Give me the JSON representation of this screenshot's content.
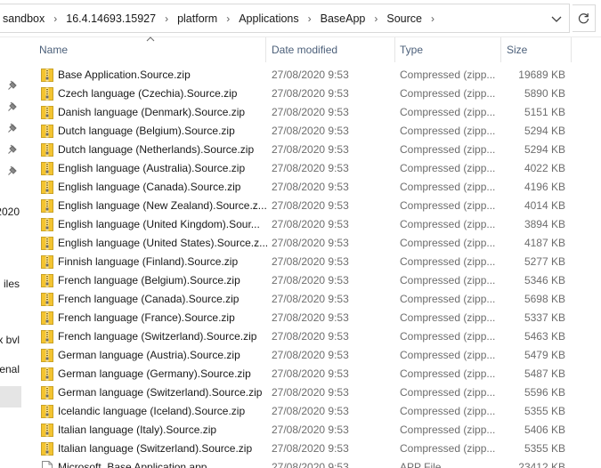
{
  "breadcrumb": [
    "sandbox",
    "16.4.14693.15927",
    "platform",
    "Applications",
    "BaseApp",
    "Source"
  ],
  "columns": {
    "name": "Name",
    "date": "Date modified",
    "type": "Type",
    "size": "Size"
  },
  "nav": {
    "pins": 5,
    "labels": [
      "2020",
      "iles",
      "x bvl",
      "enal"
    ]
  },
  "files": [
    {
      "name": "Base Application.Source.zip",
      "date": "27/08/2020 9:53",
      "type": "Compressed (zipp...",
      "size": "19689 KB",
      "icon": "zip-folder-icon"
    },
    {
      "name": "Czech language (Czechia).Source.zip",
      "date": "27/08/2020 9:53",
      "type": "Compressed (zipp...",
      "size": "5890 KB",
      "icon": "zip-folder-icon"
    },
    {
      "name": "Danish language (Denmark).Source.zip",
      "date": "27/08/2020 9:53",
      "type": "Compressed (zipp...",
      "size": "5151 KB",
      "icon": "zip-folder-icon"
    },
    {
      "name": "Dutch language (Belgium).Source.zip",
      "date": "27/08/2020 9:53",
      "type": "Compressed (zipp...",
      "size": "5294 KB",
      "icon": "zip-folder-icon"
    },
    {
      "name": "Dutch language (Netherlands).Source.zip",
      "date": "27/08/2020 9:53",
      "type": "Compressed (zipp...",
      "size": "5294 KB",
      "icon": "zip-folder-icon"
    },
    {
      "name": "English language (Australia).Source.zip",
      "date": "27/08/2020 9:53",
      "type": "Compressed (zipp...",
      "size": "4022 KB",
      "icon": "zip-folder-icon"
    },
    {
      "name": "English language (Canada).Source.zip",
      "date": "27/08/2020 9:53",
      "type": "Compressed (zipp...",
      "size": "4196 KB",
      "icon": "zip-folder-icon"
    },
    {
      "name": "English language (New Zealand).Source.z...",
      "date": "27/08/2020 9:53",
      "type": "Compressed (zipp...",
      "size": "4014 KB",
      "icon": "zip-folder-icon"
    },
    {
      "name": "English language (United Kingdom).Sour...",
      "date": "27/08/2020 9:53",
      "type": "Compressed (zipp...",
      "size": "3894 KB",
      "icon": "zip-folder-icon"
    },
    {
      "name": "English language (United States).Source.z...",
      "date": "27/08/2020 9:53",
      "type": "Compressed (zipp...",
      "size": "4187 KB",
      "icon": "zip-folder-icon"
    },
    {
      "name": "Finnish language (Finland).Source.zip",
      "date": "27/08/2020 9:53",
      "type": "Compressed (zipp...",
      "size": "5277 KB",
      "icon": "zip-folder-icon"
    },
    {
      "name": "French language (Belgium).Source.zip",
      "date": "27/08/2020 9:53",
      "type": "Compressed (zipp...",
      "size": "5346 KB",
      "icon": "zip-folder-icon"
    },
    {
      "name": "French language (Canada).Source.zip",
      "date": "27/08/2020 9:53",
      "type": "Compressed (zipp...",
      "size": "5698 KB",
      "icon": "zip-folder-icon"
    },
    {
      "name": "French language (France).Source.zip",
      "date": "27/08/2020 9:53",
      "type": "Compressed (zipp...",
      "size": "5337 KB",
      "icon": "zip-folder-icon"
    },
    {
      "name": "French language (Switzerland).Source.zip",
      "date": "27/08/2020 9:53",
      "type": "Compressed (zipp...",
      "size": "5463 KB",
      "icon": "zip-folder-icon"
    },
    {
      "name": "German language (Austria).Source.zip",
      "date": "27/08/2020 9:53",
      "type": "Compressed (zipp...",
      "size": "5479 KB",
      "icon": "zip-folder-icon"
    },
    {
      "name": "German language (Germany).Source.zip",
      "date": "27/08/2020 9:53",
      "type": "Compressed (zipp...",
      "size": "5487 KB",
      "icon": "zip-folder-icon"
    },
    {
      "name": "German language (Switzerland).Source.zip",
      "date": "27/08/2020 9:53",
      "type": "Compressed (zipp...",
      "size": "5596 KB",
      "icon": "zip-folder-icon"
    },
    {
      "name": "Icelandic language (Iceland).Source.zip",
      "date": "27/08/2020 9:53",
      "type": "Compressed (zipp...",
      "size": "5355 KB",
      "icon": "zip-folder-icon"
    },
    {
      "name": "Italian language (Italy).Source.zip",
      "date": "27/08/2020 9:53",
      "type": "Compressed (zipp...",
      "size": "5406 KB",
      "icon": "zip-folder-icon"
    },
    {
      "name": "Italian language (Switzerland).Source.zip",
      "date": "27/08/2020 9:53",
      "type": "Compressed (zipp...",
      "size": "5355 KB",
      "icon": "zip-folder-icon"
    },
    {
      "name": "Microsoft_Base Application.app",
      "date": "27/08/2020 9:53",
      "type": "APP File",
      "size": "23412 KB",
      "icon": "app-file-icon"
    }
  ],
  "colors": {
    "header_text": "#4c607a",
    "muted_text": "#6d6d6d",
    "zip_yellow": "#f4c430"
  }
}
